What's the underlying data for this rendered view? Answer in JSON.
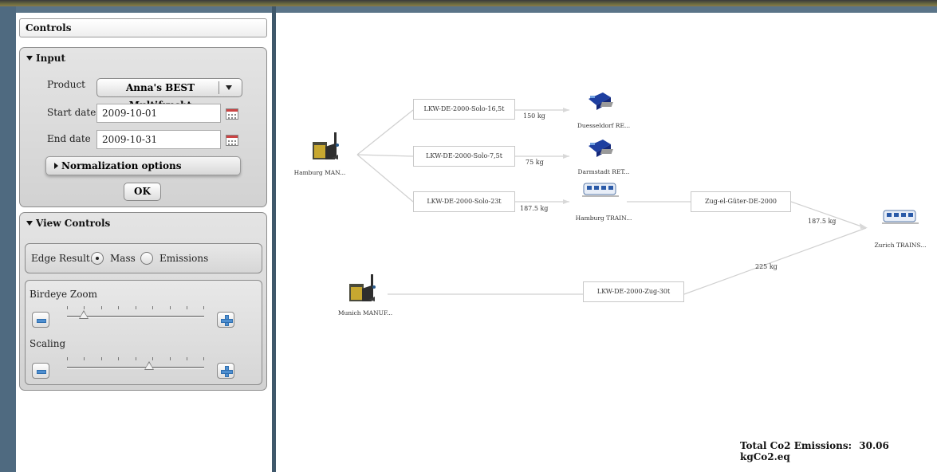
{
  "controls": {
    "title": "Controls",
    "input": {
      "title": "Input",
      "product_label": "Product",
      "product_value": "Anna's BEST Multifrucht",
      "start_label": "Start date",
      "start_value": "2009-10-01",
      "end_label": "End date",
      "end_value": "2009-10-31",
      "normalization_label": "Normalization options",
      "ok_label": "OK"
    },
    "view": {
      "title": "View Controls",
      "edge_result_label": "Edge Result:",
      "mass_label": "Mass",
      "emissions_label": "Emissions",
      "selected": "Mass",
      "birdeye_label": "Birdeye Zoom",
      "birdeye_level": 0.12,
      "scaling_label": "Scaling",
      "scaling_level": 0.6
    }
  },
  "graph": {
    "sources": [
      {
        "label": "Hamburg MAN...",
        "icon": "factory-icon"
      },
      {
        "label": "Munich MANUF...",
        "icon": "factory-icon"
      }
    ],
    "transports": [
      {
        "label": "LKW-DE-2000-Solo-16,5t",
        "weight": "150 kg"
      },
      {
        "label": "LKW-DE-2000-Solo-7,5t",
        "weight": "75 kg"
      },
      {
        "label": "LKW-DE-2000-Solo-23t",
        "weight": "187.5 kg"
      },
      {
        "label": "Zug-el-Güter-DE-2000",
        "weight": "187.5 kg"
      },
      {
        "label": "LKW-DE-2000-Zug-30t",
        "weight": "225 kg"
      }
    ],
    "destinations": [
      {
        "label": "Duesseldorf RE...",
        "icon": "retail-store-icon"
      },
      {
        "label": "Darmstadt RET...",
        "icon": "retail-store-icon"
      },
      {
        "label": "Hamburg TRAIN...",
        "icon": "train-icon"
      },
      {
        "label": "Zurich TRAINS...",
        "icon": "train-icon"
      }
    ],
    "total_label": "Total Co2 Emissions:",
    "total_value": "30.06 kgCo2.eq"
  },
  "colors": {
    "frame": "#5a7488",
    "panel": "#d8d8d8",
    "edge": "#d0d0d0",
    "accent_blue": "#4f8fd0"
  }
}
